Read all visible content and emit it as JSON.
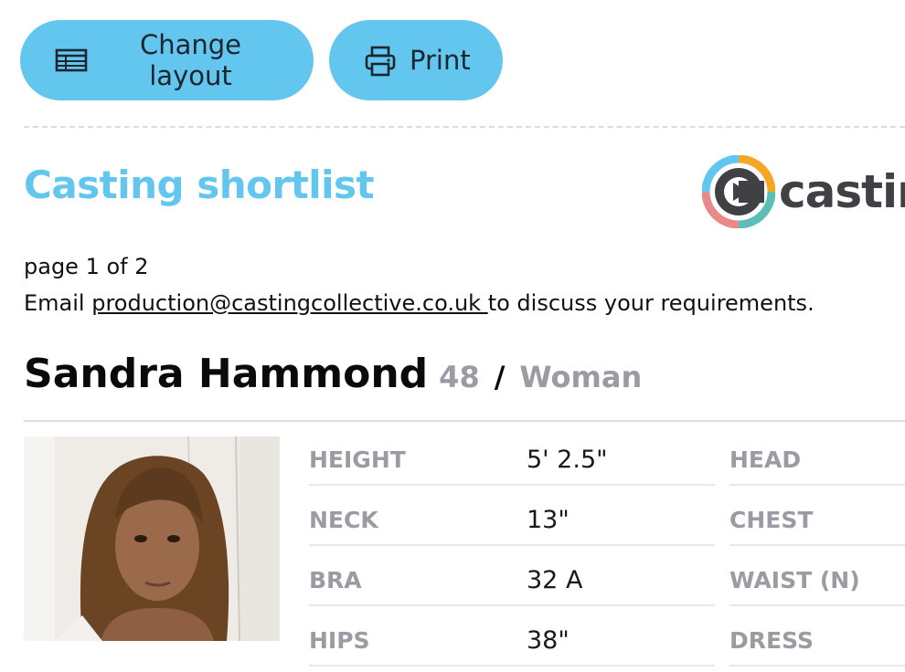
{
  "toolbar": {
    "change_layout_label": "Change layout",
    "print_label": "Print"
  },
  "header": {
    "title": "Casting shortlist",
    "logo_text": "castin"
  },
  "meta": {
    "page_info": "page 1 of 2",
    "email_prefix": "Email ",
    "email": "production@castingcollective.co.uk ",
    "email_suffix": "to discuss your requirements."
  },
  "person": {
    "name": "Sandra Hammond",
    "age": "48",
    "separator": "/",
    "gender": "Woman"
  },
  "stats": [
    {
      "label": "HEIGHT",
      "value": "5' 2.5\"",
      "label2": "HEAD"
    },
    {
      "label": "NECK",
      "value": "13\"",
      "label2": "CHEST"
    },
    {
      "label": "BRA",
      "value": "32 A",
      "label2": "WAIST (N)"
    },
    {
      "label": "HIPS",
      "value": "38\"",
      "label2": "DRESS"
    }
  ],
  "colors": {
    "accent": "#63c6ef",
    "muted": "#9b9ba3",
    "logo_orange": "#f5a623",
    "logo_teal": "#5bbfb5",
    "logo_pink": "#e88a8a",
    "logo_blue": "#63c6ef",
    "logo_dark": "#3f4145"
  },
  "icons": {
    "layout": "table-icon",
    "print": "printer-icon"
  }
}
